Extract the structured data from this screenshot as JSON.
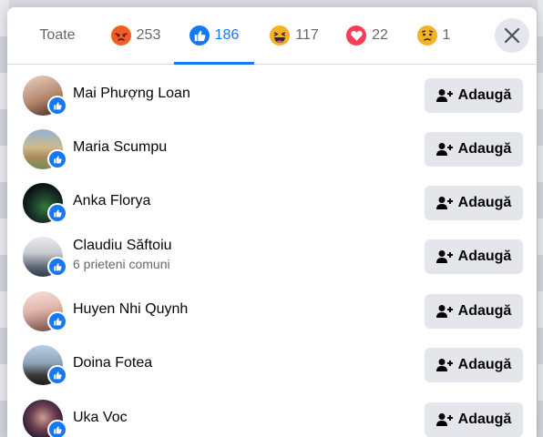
{
  "tabs": [
    {
      "label": "Toate",
      "icon": "",
      "active": false
    },
    {
      "label": "253",
      "icon": "angry-reaction-icon",
      "active": false
    },
    {
      "label": "186",
      "icon": "like-reaction-icon",
      "active": true
    },
    {
      "label": "117",
      "icon": "haha-reaction-icon",
      "active": false
    },
    {
      "label": "22",
      "icon": "love-reaction-icon",
      "active": false
    },
    {
      "label": "1",
      "icon": "sad-reaction-icon",
      "active": false
    }
  ],
  "people": [
    {
      "name": "Mai Phượng Loan",
      "subtitle": "",
      "button": "Adaugă"
    },
    {
      "name": "Maria Scumpu",
      "subtitle": "",
      "button": "Adaugă"
    },
    {
      "name": "Anka Florya",
      "subtitle": "",
      "button": "Adaugă"
    },
    {
      "name": "Claudiu Săftoiu",
      "subtitle": "6 prieteni comuni",
      "button": "Adaugă"
    },
    {
      "name": "Huyen Nhi Quynh",
      "subtitle": "",
      "button": "Adaugă"
    },
    {
      "name": "Doina Fotea",
      "subtitle": "",
      "button": "Adaugă"
    },
    {
      "name": "Uka Voc",
      "subtitle": "",
      "button": "Adaugă"
    }
  ],
  "colors": {
    "accent": "#1877f2",
    "button_bg": "#e4e6eb",
    "muted": "#65676b"
  }
}
